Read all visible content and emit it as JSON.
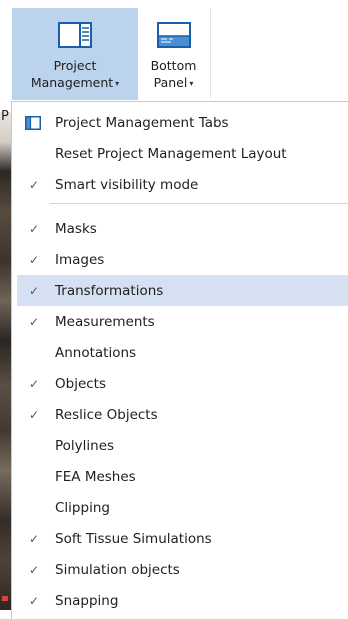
{
  "ribbon": {
    "project_management": {
      "line1": "Project",
      "line2": "Management",
      "caret": "▾"
    },
    "bottom_panel": {
      "line1": "Bottom",
      "line2": "Panel",
      "caret": "▾"
    }
  },
  "background": {
    "partial_text": "P"
  },
  "menu": {
    "items": [
      {
        "label": "Project Management Tabs",
        "checked": false,
        "icon": "panel-tabs-icon"
      },
      {
        "label": "Reset Project Management Layout",
        "checked": false
      },
      {
        "label": "Smart visibility mode",
        "checked": true
      },
      {
        "label": "Masks",
        "checked": true
      },
      {
        "label": "Images",
        "checked": true
      },
      {
        "label": "Transformations",
        "checked": true,
        "highlighted": true
      },
      {
        "label": "Measurements",
        "checked": true
      },
      {
        "label": "Annotations",
        "checked": false
      },
      {
        "label": "Objects",
        "checked": true
      },
      {
        "label": "Reslice Objects",
        "checked": true
      },
      {
        "label": "Polylines",
        "checked": false
      },
      {
        "label": "FEA Meshes",
        "checked": false
      },
      {
        "label": "Clipping",
        "checked": false
      },
      {
        "label": "Soft Tissue Simulations",
        "checked": true
      },
      {
        "label": "Simulation objects",
        "checked": true
      },
      {
        "label": "Snapping",
        "checked": true
      }
    ],
    "check_glyph": "✓"
  },
  "colors": {
    "ribbon_active": "#bcd3ee",
    "menu_highlight": "#d5e1f2",
    "icon_blue": "#1a5ea8"
  }
}
